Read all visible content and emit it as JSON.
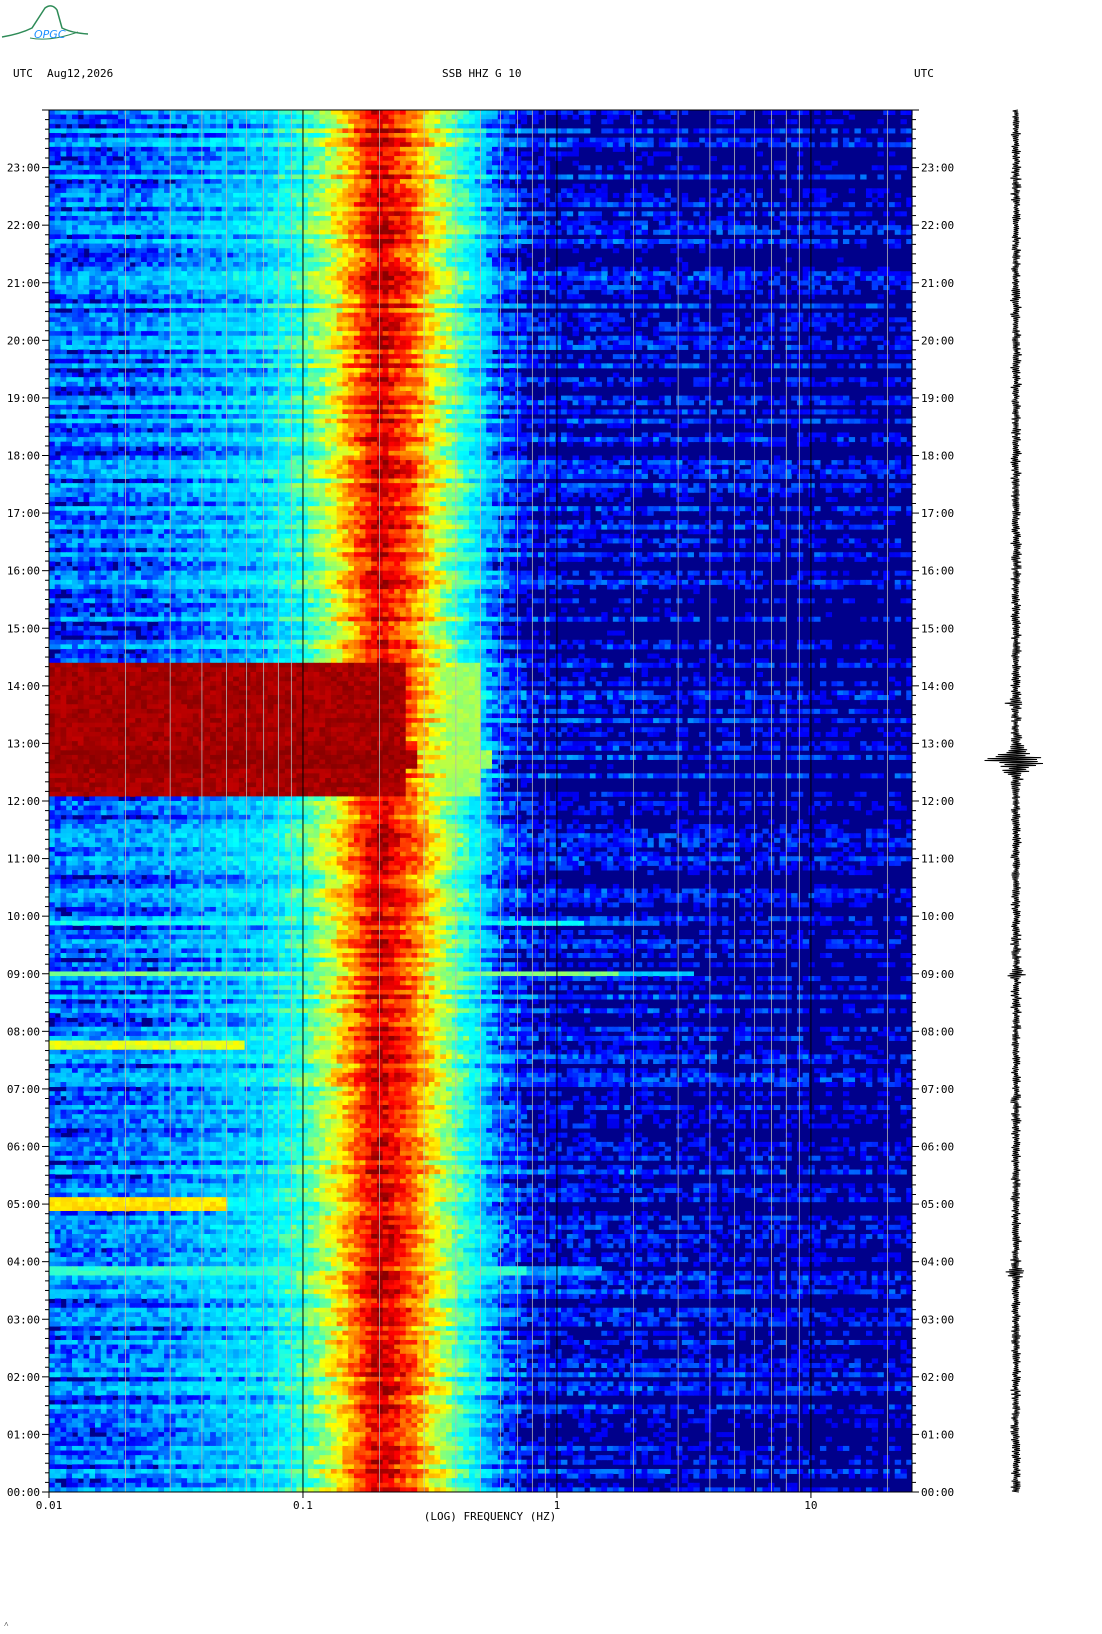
{
  "header": {
    "left_tz": "UTC",
    "date": "Aug12,2026",
    "station": "SSB HHZ G 10",
    "right_tz": "UTC"
  },
  "logo": {
    "text": "OPGC",
    "color": "#2e8b57"
  },
  "footer": {
    "mark": "˄"
  },
  "chart_data": {
    "type": "heatmap",
    "title": "SSB HHZ G 10",
    "xlabel": "(LOG) FREQUENCY (HZ)",
    "ylabel": "",
    "x_scale": "log",
    "xlim": [
      0.01,
      25
    ],
    "x_ticks": [
      {
        "value": 0.01,
        "label": "0.01"
      },
      {
        "value": 0.1,
        "label": "0.1"
      },
      {
        "value": 1,
        "label": "1"
      },
      {
        "value": 10,
        "label": "10"
      }
    ],
    "y_unit": "hour UTC",
    "ylim": [
      0,
      24
    ],
    "y_ticks": [
      "00:00",
      "01:00",
      "02:00",
      "03:00",
      "04:00",
      "05:00",
      "06:00",
      "07:00",
      "08:00",
      "09:00",
      "10:00",
      "11:00",
      "12:00",
      "13:00",
      "14:00",
      "15:00",
      "16:00",
      "17:00",
      "18:00",
      "19:00",
      "20:00",
      "21:00",
      "22:00",
      "23:00"
    ],
    "colormap": [
      "#00008b",
      "#0000ff",
      "#00bfff",
      "#00ffff",
      "#7fff7f",
      "#ffff00",
      "#ff7f00",
      "#ff0000",
      "#8b0000"
    ],
    "background_profile": [
      {
        "freq": 0.01,
        "level": 0.18
      },
      {
        "freq": 0.024,
        "level": 0.2
      },
      {
        "freq": 0.07,
        "level": 0.3
      },
      {
        "freq": 0.1,
        "level": 0.42
      },
      {
        "freq": 0.13,
        "level": 0.58
      },
      {
        "freq": 0.17,
        "level": 0.8
      },
      {
        "freq": 0.2,
        "level": 0.93
      },
      {
        "freq": 0.26,
        "level": 0.8
      },
      {
        "freq": 0.33,
        "level": 0.6
      },
      {
        "freq": 0.45,
        "level": 0.38
      },
      {
        "freq": 0.6,
        "level": 0.18
      },
      {
        "freq": 0.8,
        "level": 0.1
      },
      {
        "freq": 25,
        "level": 0.06
      }
    ],
    "events": [
      {
        "time_start": 12.1,
        "time_end": 14.4,
        "freq_max": 0.5,
        "level": 0.97
      },
      {
        "time_start": 12.55,
        "time_end": 12.85,
        "freq_max": 0.55,
        "level": 0.98
      },
      {
        "time_start": 8.95,
        "time_end": 9.05,
        "freq_max": 3.5,
        "level": 0.5
      },
      {
        "time_start": 7.7,
        "time_end": 7.85,
        "freq_max": 0.12,
        "level": 0.6
      },
      {
        "time_start": 4.9,
        "time_end": 5.15,
        "freq_max": 0.1,
        "level": 0.65
      },
      {
        "time_start": 3.8,
        "time_end": 3.9,
        "freq_max": 1.5,
        "level": 0.42
      },
      {
        "time_start": 9.85,
        "time_end": 9.92,
        "freq_max": 2.5,
        "level": 0.38
      }
    ],
    "seismogram": {
      "max_amplitude_time": 12.7,
      "burst_times": [
        12.7,
        9.0,
        13.7,
        3.8
      ]
    },
    "grid": true
  }
}
